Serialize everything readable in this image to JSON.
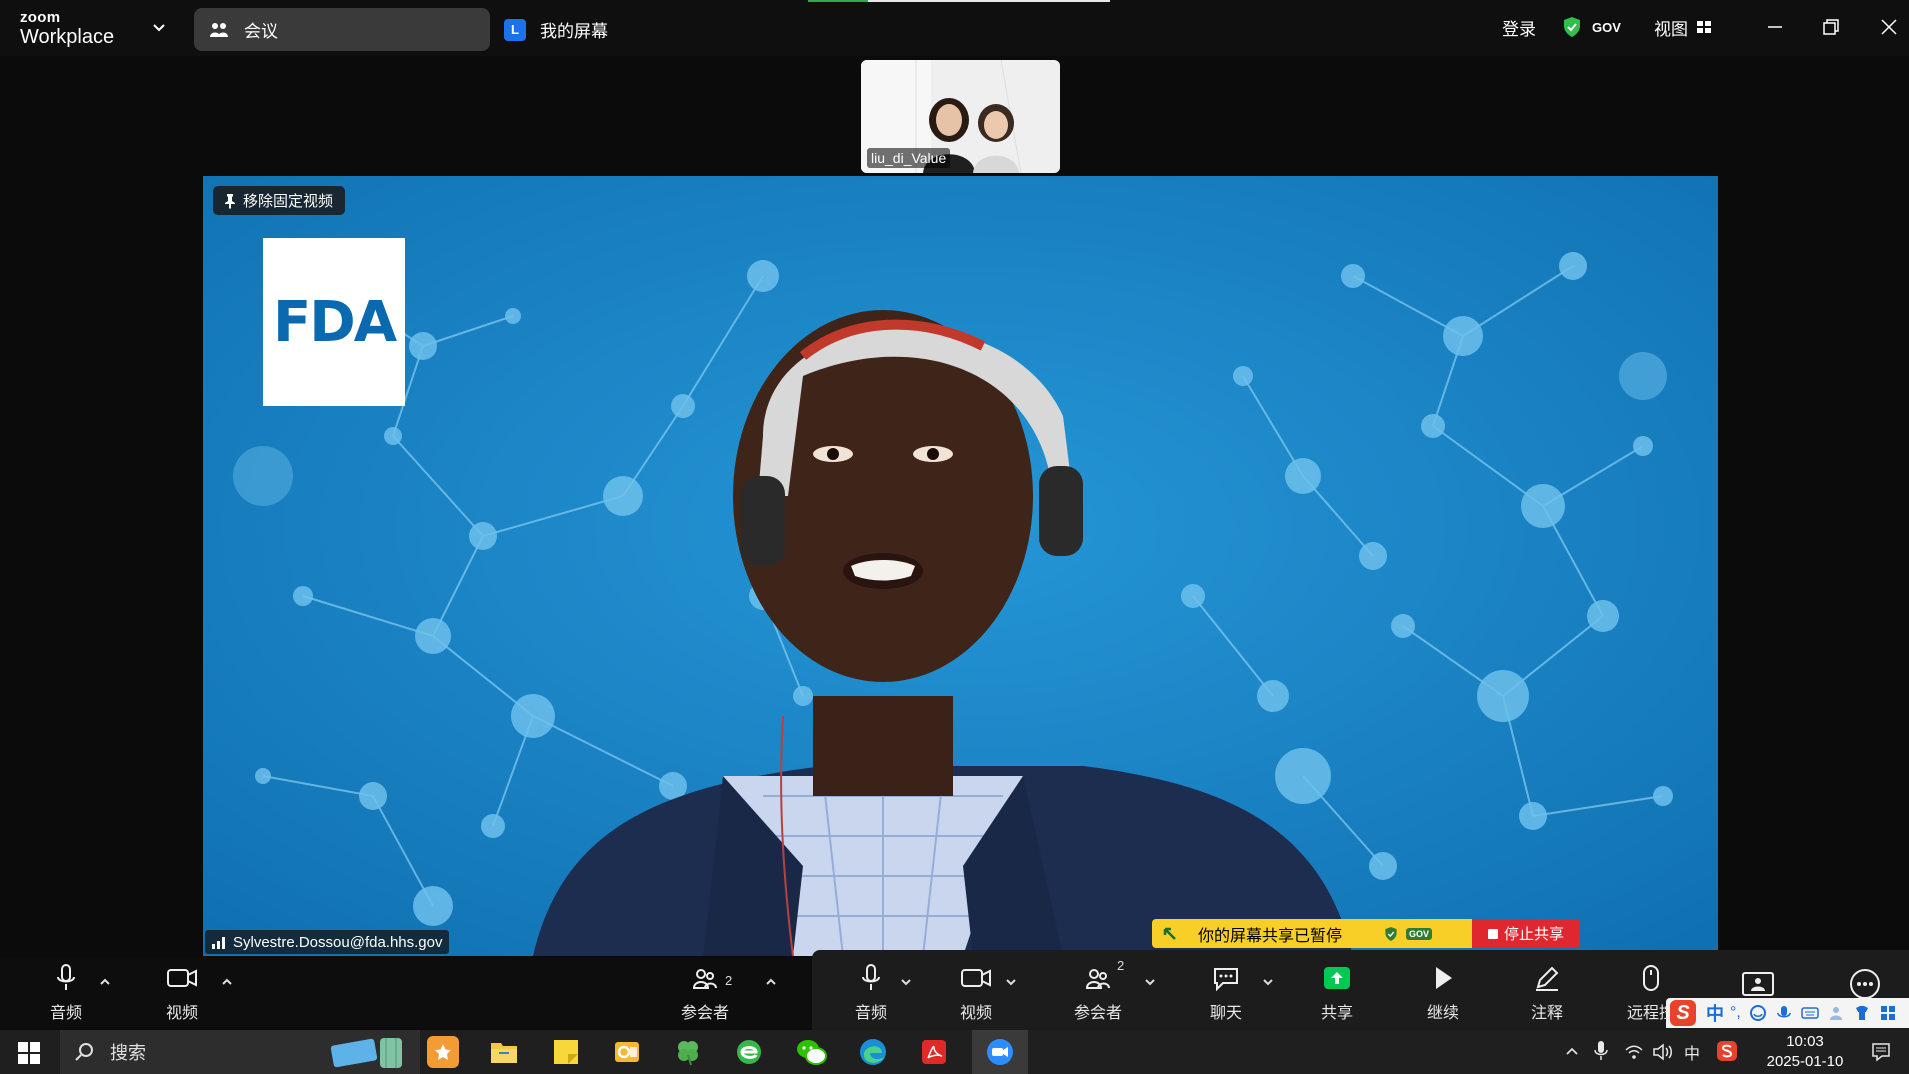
{
  "titlebar": {
    "brand_top": "zoom",
    "brand_bottom": "Workplace",
    "tab_meeting": "会议",
    "tab_screen_badge": "L",
    "tab_screen": "我的屏幕",
    "login": "登录",
    "gov": "GOV",
    "view": "视图"
  },
  "thumbnail": {
    "name": "liu_di_Value"
  },
  "main_video": {
    "pin_label": "移除固定视频",
    "logo_text": "FDA",
    "speaker_name": "Sylvestre.Dossou@fda.hhs.gov"
  },
  "share_banner": {
    "text": "你的屏幕共享已暂停",
    "gov": "GOV",
    "stop": "停止共享"
  },
  "left_toolbar": {
    "audio": "音频",
    "video": "视频",
    "participants": "参会者",
    "participants_count": "2"
  },
  "share_toolbar": {
    "audio": "音频",
    "video": "视频",
    "participants": "参会者",
    "participants_count": "2",
    "chat": "聊天",
    "share": "共享",
    "resume": "继续",
    "annotate": "注释",
    "remote": "远程控"
  },
  "ime": {
    "lang": "中",
    "punct": "°,"
  },
  "taskbar": {
    "search": "搜索",
    "ime_lang": "中",
    "time": "10:03",
    "date": "2025-01-10"
  },
  "colors": {
    "accent_blue": "#1a7fc1",
    "share_green": "#00c853",
    "banner_yellow": "#f7cf26",
    "stop_red": "#e0262f"
  }
}
